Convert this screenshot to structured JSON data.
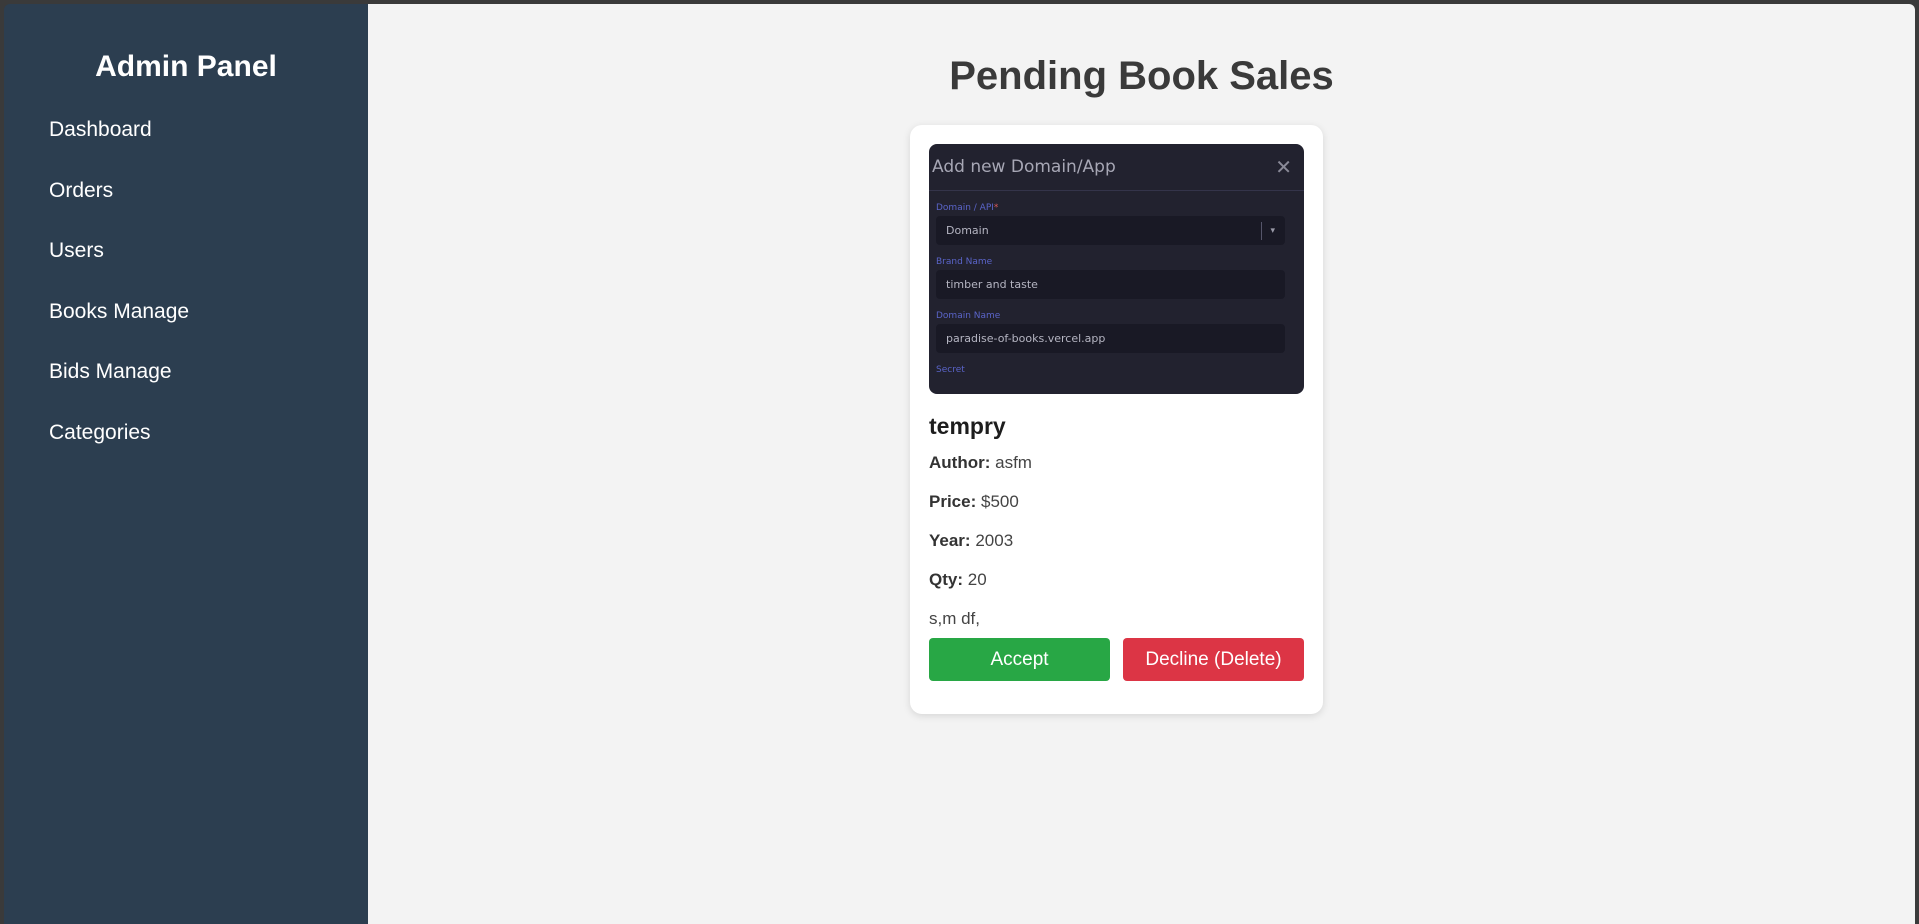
{
  "sidebar": {
    "title": "Admin Panel",
    "items": [
      {
        "label": "Dashboard"
      },
      {
        "label": "Orders"
      },
      {
        "label": "Users"
      },
      {
        "label": "Books Manage"
      },
      {
        "label": "Bids Manage"
      },
      {
        "label": "Categories"
      }
    ]
  },
  "main": {
    "title": "Pending Book Sales"
  },
  "card": {
    "image": {
      "header_title": "Add new Domain/App",
      "close_glyph": "✕",
      "fields": [
        {
          "label": "Domain / API",
          "required_mark": "*",
          "value": "Domain",
          "arrow": "▾"
        },
        {
          "label": "Brand Name",
          "value": "timber and taste"
        },
        {
          "label": "Domain Name",
          "value": "paradise-of-books.vercel.app"
        },
        {
          "label": "Secret"
        }
      ]
    },
    "book_title": "tempry",
    "author_label": "Author:",
    "author": "asfm",
    "price_label": "Price:",
    "price": "$500",
    "year_label": "Year:",
    "year": "2003",
    "qty_label": "Qty:",
    "qty": "20",
    "description": "s,m df,",
    "accept_label": "Accept",
    "decline_label": "Decline (Delete)"
  },
  "colors": {
    "sidebar_bg": "#2c3e50",
    "main_bg": "#f3f3f3",
    "accept": "#28a745",
    "decline": "#dc3545"
  }
}
